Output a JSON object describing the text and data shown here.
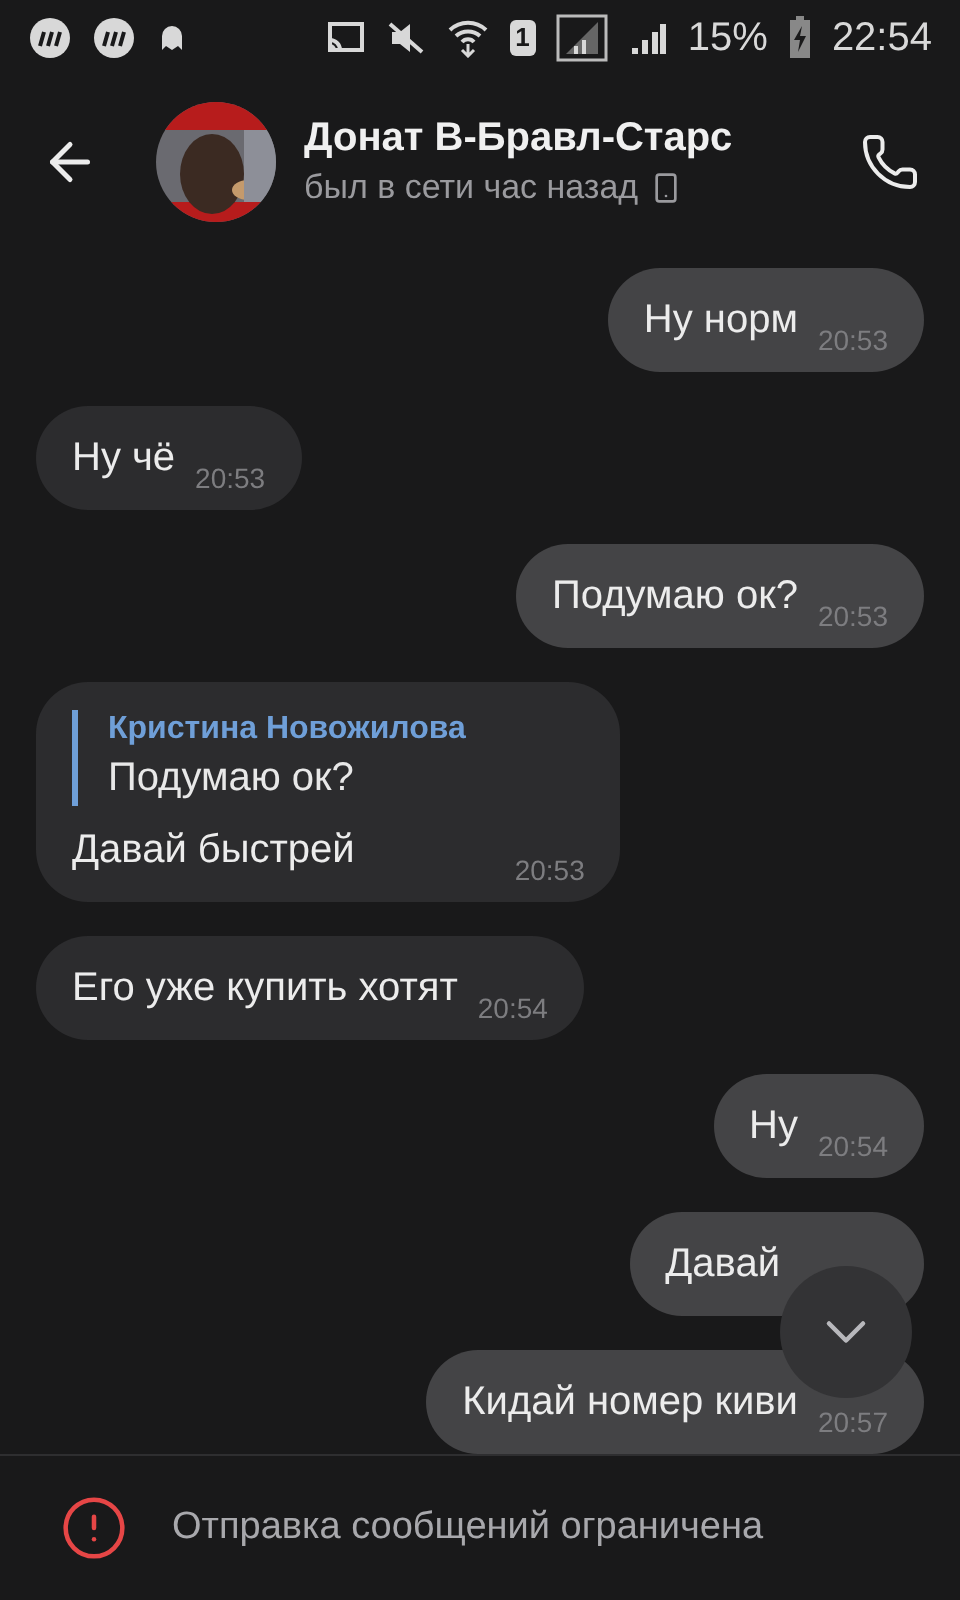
{
  "status_bar": {
    "sim": "1",
    "battery": "15%",
    "time": "22:54"
  },
  "header": {
    "title": "Донат В-Бравл-Старс",
    "status": "был в сети час назад"
  },
  "messages": [
    {
      "kind": "out",
      "text": "Ну норм",
      "time": "20:53"
    },
    {
      "kind": "in",
      "text": "Ну чё",
      "time": "20:53"
    },
    {
      "kind": "out",
      "text": "Подумаю ок?",
      "time": "20:53"
    },
    {
      "kind": "in",
      "quote": {
        "author": "Кристина Новожилова",
        "text": "Подумаю ок?"
      },
      "text": "Давай быстрей",
      "time": "20:53"
    },
    {
      "kind": "in",
      "text": "Его уже купить хотят",
      "time": "20:54"
    },
    {
      "kind": "out",
      "text": "Ну",
      "time": "20:54"
    },
    {
      "kind": "out",
      "text": "Давай"
    },
    {
      "kind": "out",
      "text": "Кидай номер киви",
      "time": "20:57"
    }
  ],
  "notice": "Отправка сообщений ограничена"
}
